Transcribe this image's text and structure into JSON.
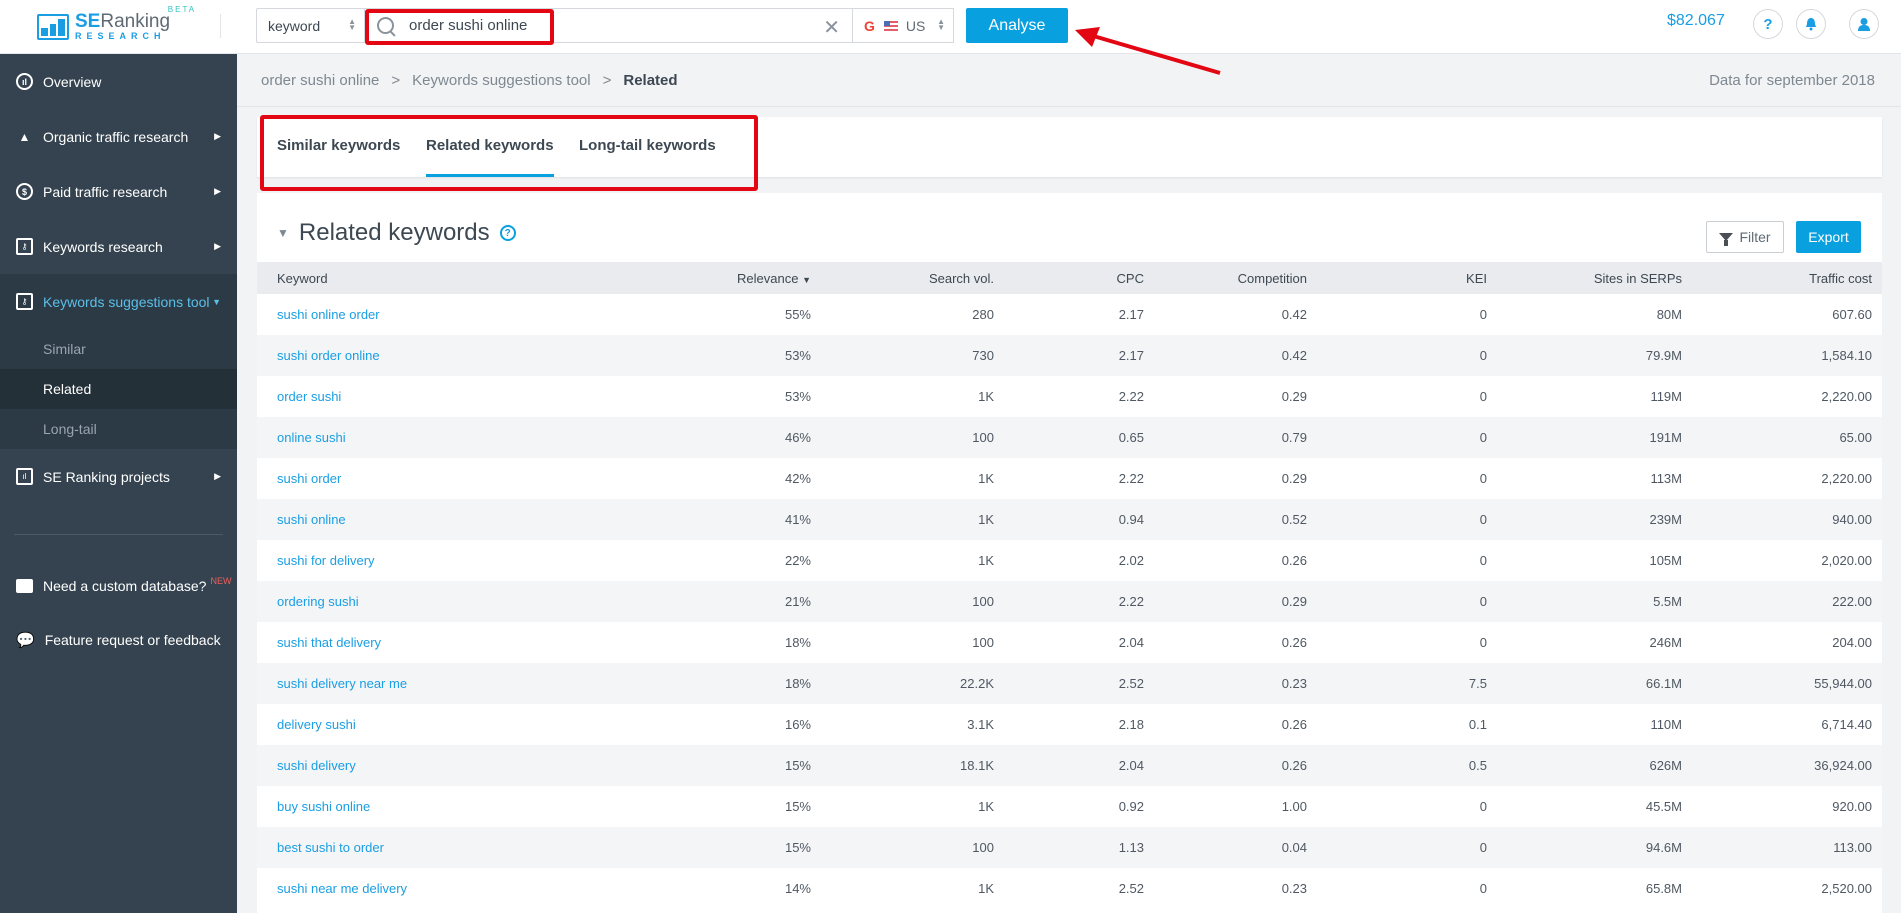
{
  "header": {
    "logo": {
      "brand_bold": "SE",
      "brand_rest": "Ranking",
      "subtitle": "RESEARCH",
      "badge": "BETA"
    },
    "search_type": "keyword",
    "search_value": "order sushi online",
    "search_placeholder": "",
    "engine": {
      "icon": "G",
      "country": "US"
    },
    "analyse_label": "Analyse",
    "balance": "$82.067",
    "help_label": "?",
    "annotation_color": "#e30613",
    "accent_color": "#09a0e0"
  },
  "sidebar": {
    "items": [
      {
        "label": "Overview",
        "icon": "chart-circle-icon"
      },
      {
        "label": "Organic traffic research",
        "icon": "organic-icon"
      },
      {
        "label": "Paid traffic research",
        "icon": "dollar-icon"
      },
      {
        "label": "Keywords research",
        "icon": "key-icon"
      },
      {
        "label": "Keywords suggestions tool",
        "icon": "suggestions-icon"
      }
    ],
    "sub_items": [
      "Similar",
      "Related",
      "Long-tail"
    ],
    "projects_label": "SE Ranking projects",
    "custom_db_label": "Need a custom database?",
    "new_badge": "NEW",
    "feedback_label": "Feature request or feedback"
  },
  "breadcrumb": {
    "items": [
      "order sushi online",
      "Keywords suggestions tool",
      "Related"
    ],
    "separator": ">"
  },
  "data_for": "Data for september 2018",
  "tabs": [
    {
      "label": "Similar keywords",
      "active": false
    },
    {
      "label": "Related keywords",
      "active": true
    },
    {
      "label": "Long-tail keywords",
      "active": false
    }
  ],
  "section": {
    "title": "Related keywords",
    "help": "?",
    "filter_label": "Filter",
    "export_label": "Export"
  },
  "table": {
    "columns": [
      "Keyword",
      "Relevance",
      "Search vol.",
      "CPC",
      "Competition",
      "KEI",
      "Sites in SERPs",
      "Traffic cost"
    ],
    "sort_indicator": "▼",
    "rows": [
      [
        "sushi online order",
        "55%",
        "280",
        "2.17",
        "0.42",
        "0",
        "80M",
        "607.60"
      ],
      [
        "sushi order online",
        "53%",
        "730",
        "2.17",
        "0.42",
        "0",
        "79.9M",
        "1,584.10"
      ],
      [
        "order sushi",
        "53%",
        "1K",
        "2.22",
        "0.29",
        "0",
        "119M",
        "2,220.00"
      ],
      [
        "online sushi",
        "46%",
        "100",
        "0.65",
        "0.79",
        "0",
        "191M",
        "65.00"
      ],
      [
        "sushi order",
        "42%",
        "1K",
        "2.22",
        "0.29",
        "0",
        "113M",
        "2,220.00"
      ],
      [
        "sushi online",
        "41%",
        "1K",
        "0.94",
        "0.52",
        "0",
        "239M",
        "940.00"
      ],
      [
        "sushi for delivery",
        "22%",
        "1K",
        "2.02",
        "0.26",
        "0",
        "105M",
        "2,020.00"
      ],
      [
        "ordering sushi",
        "21%",
        "100",
        "2.22",
        "0.29",
        "0",
        "5.5M",
        "222.00"
      ],
      [
        "sushi that delivery",
        "18%",
        "100",
        "2.04",
        "0.26",
        "0",
        "246M",
        "204.00"
      ],
      [
        "sushi delivery near me",
        "18%",
        "22.2K",
        "2.52",
        "0.23",
        "7.5",
        "66.1M",
        "55,944.00"
      ],
      [
        "delivery sushi",
        "16%",
        "3.1K",
        "2.18",
        "0.26",
        "0.1",
        "110M",
        "6,714.40"
      ],
      [
        "sushi delivery",
        "15%",
        "18.1K",
        "2.04",
        "0.26",
        "0.5",
        "626M",
        "36,924.00"
      ],
      [
        "buy sushi online",
        "15%",
        "1K",
        "0.92",
        "1.00",
        "0",
        "45.5M",
        "920.00"
      ],
      [
        "best sushi to order",
        "15%",
        "100",
        "1.13",
        "0.04",
        "0",
        "94.6M",
        "113.00"
      ],
      [
        "sushi near me delivery",
        "14%",
        "1K",
        "2.52",
        "0.23",
        "0",
        "65.8M",
        "2,520.00"
      ]
    ]
  }
}
